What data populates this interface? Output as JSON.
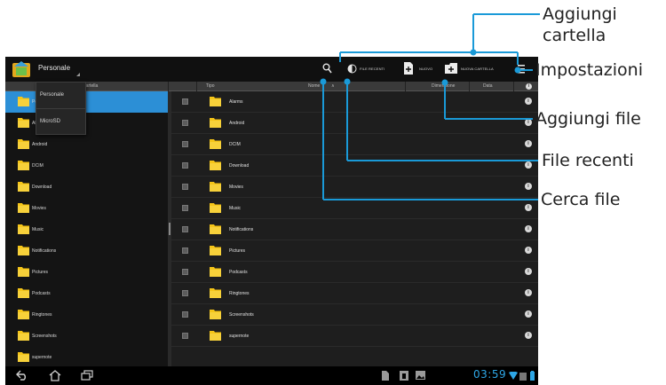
{
  "app": {
    "title": "Personale",
    "icons": {
      "logo": "asus-file-manager-logo",
      "search": "search-icon",
      "recent": "recent-files-icon",
      "new_file": "add-file-icon",
      "new_folder": "add-folder-icon",
      "settings": "settings-icon"
    }
  },
  "toolbar": {
    "recent_label": "FILE RECENTI",
    "new_file_label": "NUOVO",
    "new_folder_label": "NUOVA CARTELLA"
  },
  "headers": {
    "tree_header": "Cartella",
    "type": "Tipo",
    "name": "Nome",
    "sort_arrow": "∧",
    "size": "Dimensione",
    "date": "Data"
  },
  "dropdown": {
    "items": [
      "Personale",
      "MicroSD"
    ]
  },
  "tree": {
    "items": [
      {
        "label": "Personale",
        "selected": true
      },
      {
        "label": "Alarms"
      },
      {
        "label": "Android"
      },
      {
        "label": "DCIM"
      },
      {
        "label": "Download"
      },
      {
        "label": "Movies"
      },
      {
        "label": "Music"
      },
      {
        "label": "Notifications"
      },
      {
        "label": "Pictures"
      },
      {
        "label": "Podcasts"
      },
      {
        "label": "Ringtones"
      },
      {
        "label": "Screenshots"
      },
      {
        "label": "supernote"
      }
    ]
  },
  "files": {
    "rows": [
      {
        "name": "Alarms"
      },
      {
        "name": "Android"
      },
      {
        "name": "DCIM"
      },
      {
        "name": "Download"
      },
      {
        "name": "Movies"
      },
      {
        "name": "Music"
      },
      {
        "name": "Notifications"
      },
      {
        "name": "Pictures"
      },
      {
        "name": "Podcasts"
      },
      {
        "name": "Ringtones"
      },
      {
        "name": "Screenshots"
      },
      {
        "name": "supernote"
      }
    ],
    "info_glyph": "i"
  },
  "statusbar": {
    "clock": "03:59",
    "icons": [
      "back-icon",
      "home-icon",
      "recent-apps-icon",
      "notification-icons",
      "wifi-icon",
      "battery-icon"
    ]
  },
  "callouts": {
    "aggiungi_cartella": "Aggiungi cartella",
    "aggiungi_cartella_line1": "Aggiungi",
    "aggiungi_cartella_line2": "cartella",
    "impostazioni": "Impostazioni",
    "aggiungi_file": "Aggiungi file",
    "file_recenti": "File recenti",
    "cerca_file": "Cerca file"
  },
  "colors": {
    "accent_blue": "#2c8fd6",
    "callout_line": "#1a9ad8",
    "folder_yellow": "#f5c518",
    "clock_blue": "#2ea7e6"
  }
}
